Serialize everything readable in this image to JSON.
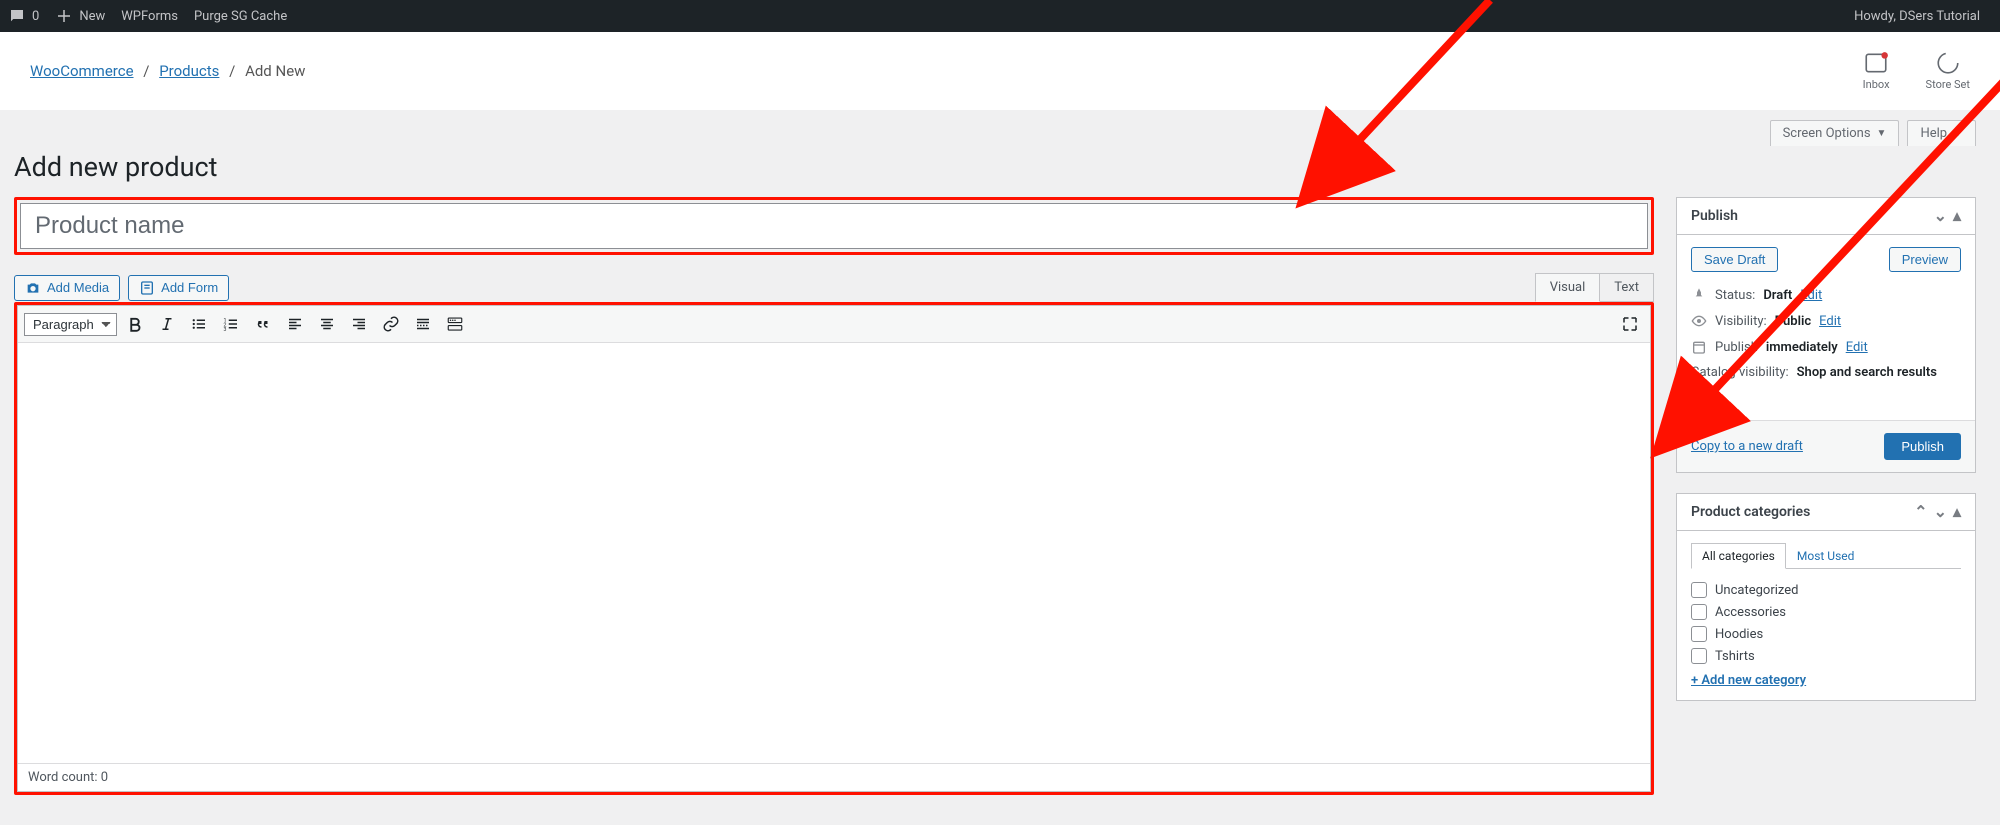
{
  "adminbar": {
    "comment_count": "0",
    "new_label": "New",
    "wpforms": "WPForms",
    "purge": "Purge SG Cache",
    "howdy": "Howdy, DSers Tutorial"
  },
  "breadcrumb": {
    "woocommerce": "WooCommerce",
    "products": "Products",
    "addnew": "Add New"
  },
  "tools": {
    "inbox": "Inbox",
    "store": "Store Set"
  },
  "screen_tabs": {
    "options": "Screen Options",
    "help": "Help"
  },
  "page_title": "Add new product",
  "title_placeholder": "Product name",
  "media_buttons": {
    "add_media": "Add Media",
    "add_form": "Add Form"
  },
  "editor_tabs": {
    "visual": "Visual",
    "text": "Text"
  },
  "format_select": "Paragraph",
  "word_count_label": "Word count: ",
  "word_count_value": "0",
  "publish": {
    "title": "Publish",
    "save_draft": "Save Draft",
    "preview": "Preview",
    "status_label": "Status:",
    "status_value": "Draft",
    "visibility_label": "Visibility:",
    "visibility_value": "Public",
    "publish_label": "Publish",
    "publish_value": "immediately",
    "catalog_label": "Catalog visibility:",
    "catalog_value": "Shop and search results",
    "edit": "Edit",
    "copy": "Copy to a new draft",
    "publish_btn": "Publish"
  },
  "categories": {
    "title": "Product categories",
    "tab_all": "All categories",
    "tab_most": "Most Used",
    "items": [
      "Uncategorized",
      "Accessories",
      "Hoodies",
      "Tshirts"
    ],
    "add_new": "+ Add new category"
  }
}
